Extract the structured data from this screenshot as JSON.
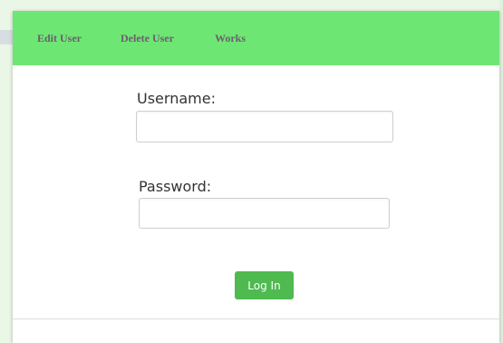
{
  "navbar": {
    "items": [
      {
        "label": "Edit User"
      },
      {
        "label": "Delete User"
      },
      {
        "label": "Works"
      }
    ],
    "background": "#6ee674"
  },
  "login_form": {
    "username_label": "Username:",
    "username_value": "",
    "password_label": "Password:",
    "password_value": "",
    "submit_label": "Log In",
    "submit_color": "#4fba4f"
  }
}
